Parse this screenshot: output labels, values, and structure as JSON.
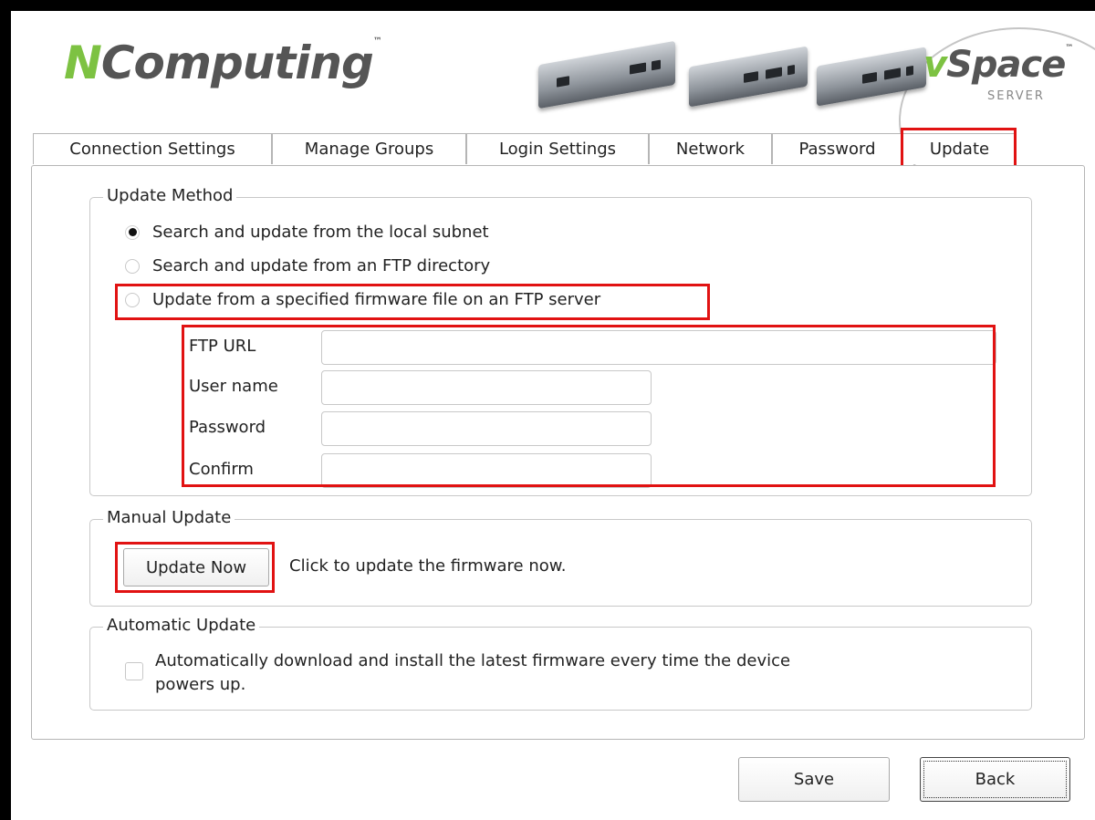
{
  "brand": {
    "logo_initial": "N",
    "logo_rest": "Computing",
    "logo_tm": "™",
    "product_v": "v",
    "product_rest": "Space",
    "product_tm": "™",
    "product_sub": "SERVER"
  },
  "tabs": [
    {
      "label": "Connection Settings"
    },
    {
      "label": "Manage Groups"
    },
    {
      "label": "Login Settings"
    },
    {
      "label": "Network"
    },
    {
      "label": "Password"
    },
    {
      "label": "Update"
    }
  ],
  "active_tab": "Update",
  "update_method": {
    "legend": "Update Method",
    "options": [
      {
        "label": "Search and update from the local subnet",
        "checked": true
      },
      {
        "label": "Search and update from an FTP directory",
        "checked": false
      },
      {
        "label": "Update from a specified firmware file on an FTP server",
        "checked": false
      }
    ],
    "ftp_fields": [
      {
        "label": "FTP URL",
        "value": ""
      },
      {
        "label": "User name",
        "value": ""
      },
      {
        "label": "Password",
        "value": ""
      },
      {
        "label": "Confirm",
        "value": ""
      }
    ]
  },
  "manual_update": {
    "legend": "Manual Update",
    "button_label": "Update Now",
    "description": "Click to update the firmware now."
  },
  "automatic_update": {
    "legend": "Automatic Update",
    "checkbox_line1": "Automatically download and install the latest firmware every time the device",
    "checkbox_line2": "powers up.",
    "checked": false
  },
  "footer": {
    "save_label": "Save",
    "back_label": "Back"
  },
  "highlight_color": "#e11212",
  "accent_color": "#7dc242"
}
